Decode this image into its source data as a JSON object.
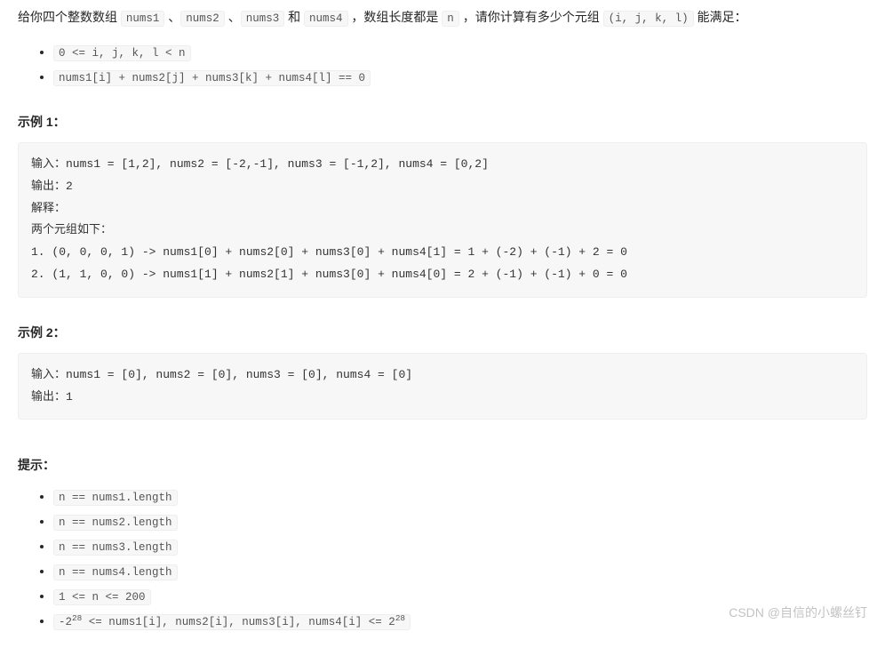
{
  "intro": {
    "seg1": "给你四个整数数组 ",
    "c1": "nums1",
    "seg2": " 、",
    "c2": "nums2",
    "seg3": " 、",
    "c3": "nums3",
    "seg4": " 和 ",
    "c4": "nums4",
    "seg5": " ，数组长度都是 ",
    "c5": "n",
    "seg6": " ，请你计算有多少个元组 ",
    "c6": "(i, j, k, l)",
    "seg7": " 能满足："
  },
  "conditions": {
    "a": "0 <= i, j, k, l < n",
    "b": "nums1[i] + nums2[j] + nums3[k] + nums4[l] == 0"
  },
  "example1": {
    "title": "示例 1：",
    "code": "输入：nums1 = [1,2], nums2 = [-2,-1], nums3 = [-1,2], nums4 = [0,2]\n输出：2\n解释：\n两个元组如下：\n1. (0, 0, 0, 1) -> nums1[0] + nums2[0] + nums3[0] + nums4[1] = 1 + (-2) + (-1) + 2 = 0\n2. (1, 1, 0, 0) -> nums1[1] + nums2[1] + nums3[0] + nums4[0] = 2 + (-1) + (-1) + 0 = 0"
  },
  "example2": {
    "title": "示例 2：",
    "code": "输入：nums1 = [0], nums2 = [0], nums3 = [0], nums4 = [0]\n输出：1"
  },
  "hints": {
    "title": "提示：",
    "items": {
      "a": "n == nums1.length",
      "b": "n == nums2.length",
      "c": "n == nums3.length",
      "d": "n == nums4.length",
      "e": "1 <= n <= 200"
    },
    "last": {
      "p1": "-2",
      "s1": "28",
      "p2": " <= nums1[i], nums2[i], nums3[i], nums4[i] <= 2",
      "s2": "28"
    }
  },
  "watermark": "CSDN @自信的小螺丝钉"
}
